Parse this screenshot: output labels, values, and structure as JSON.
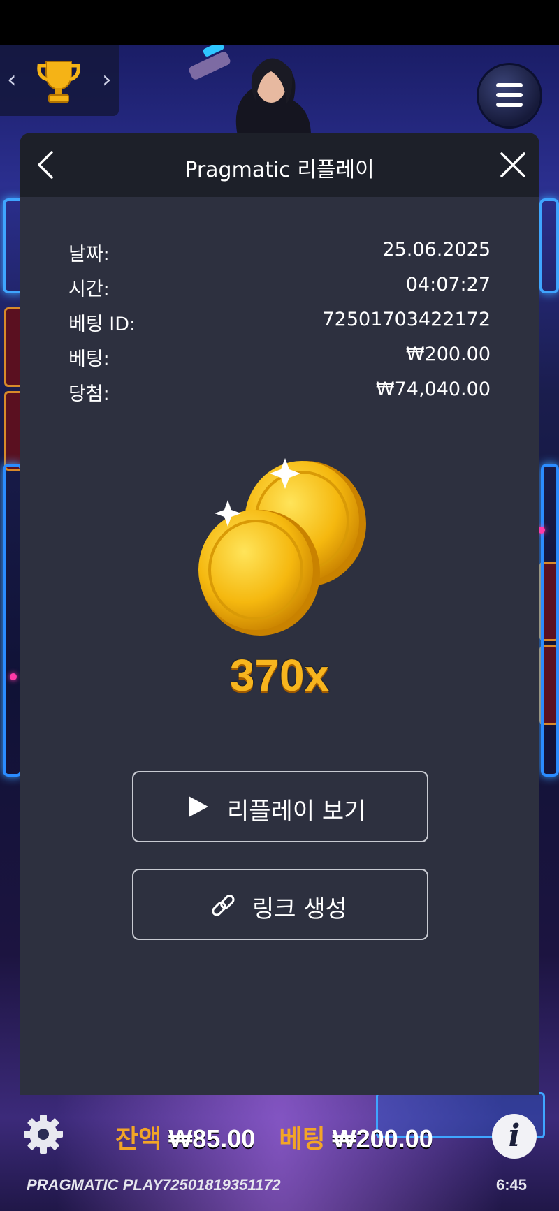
{
  "modal": {
    "title": "Pragmatic 리플레이",
    "rows": [
      {
        "label": "날짜:",
        "value": "25.06.2025"
      },
      {
        "label": "시간:",
        "value": "04:07:27"
      },
      {
        "label": "베팅 ID:",
        "value": "72501703422172"
      },
      {
        "label": "베팅:",
        "value": "₩200.00"
      },
      {
        "label": "당첨:",
        "value": "₩74,040.00"
      }
    ],
    "multiplier": "370x",
    "watch_replay_label": "리플레이 보기",
    "create_link_label": "링크 생성"
  },
  "bottom_bar": {
    "balance_label": "잔액",
    "balance_value": "₩85.00",
    "bet_label": "베팅",
    "bet_value": "₩200.00",
    "brand": "PRAGMATIC PLAY",
    "round_id": "72501819351172",
    "clock": "6:45"
  },
  "icons": {
    "trophy": "trophy-icon",
    "menu": "hamburger-menu-icon",
    "back": "chevron-left-icon",
    "close": "close-icon",
    "play": "play-icon",
    "link": "link-icon",
    "settings": "gear-icon",
    "info": "info-icon"
  },
  "colors": {
    "modal_bg": "#2d303f",
    "header_bg": "#1d2029",
    "multiplier": "#f7b51e",
    "bottom_label": "#f3a526"
  }
}
